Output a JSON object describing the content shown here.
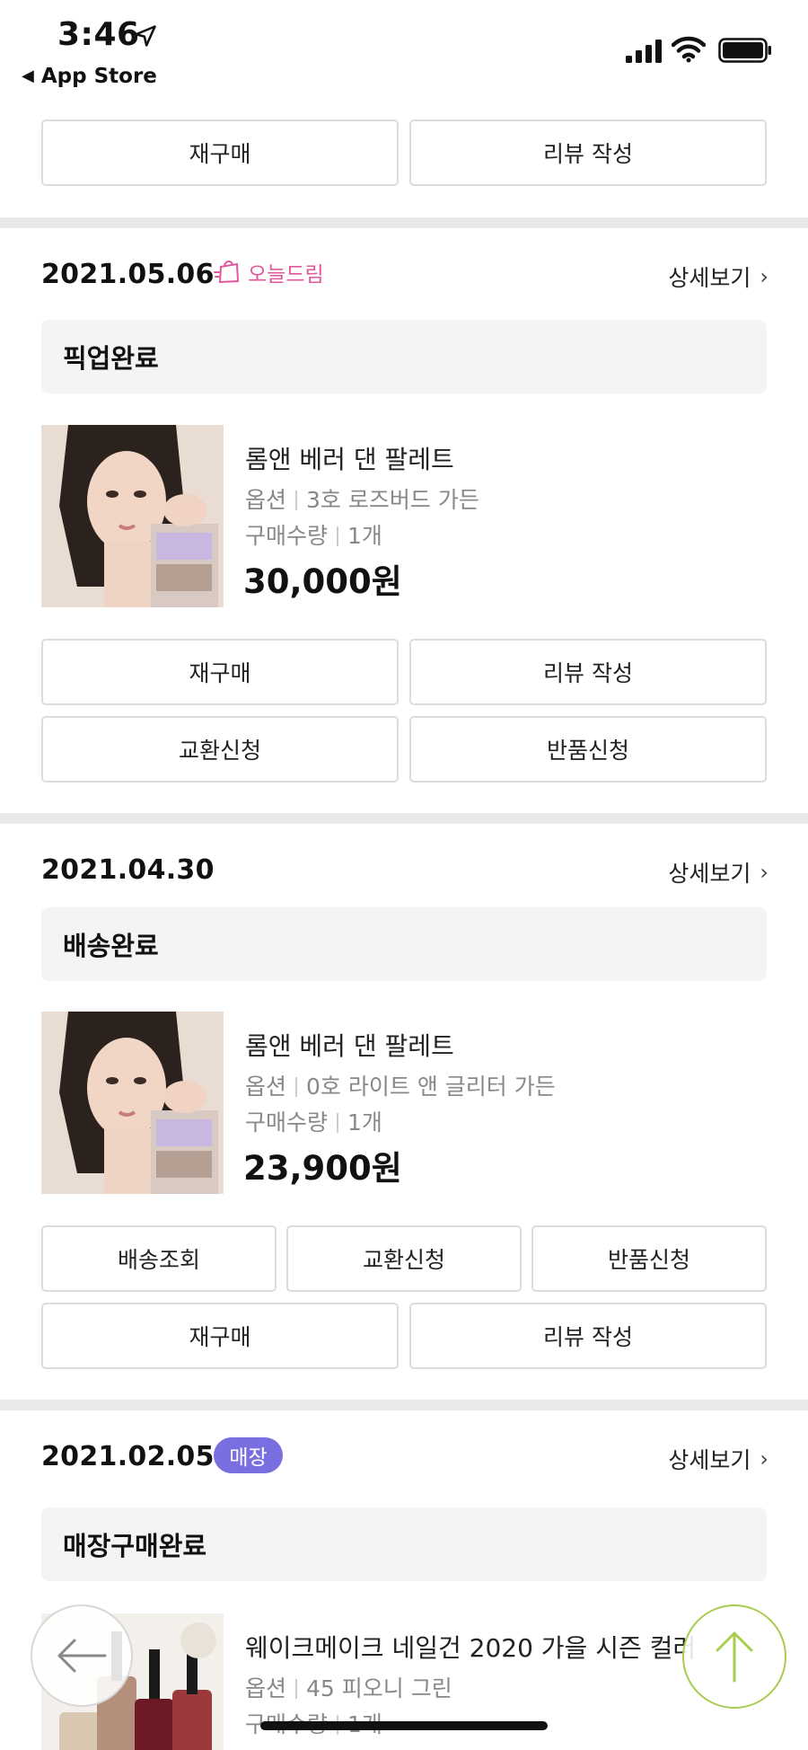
{
  "status_bar": {
    "time": "3:46",
    "back_label": "App Store"
  },
  "top_actions": {
    "rebuy": "재구매",
    "review": "리뷰 작성"
  },
  "orders": [
    {
      "date": "2021.05.06",
      "tag": "오늘드림",
      "detail": "상세보기",
      "status": "픽업완료",
      "product": {
        "name": "롬앤 베러 댄 팔레트",
        "option_label": "옵션",
        "option": "3호 로즈버드 가든",
        "qty_label": "구매수량",
        "qty": "1개",
        "price": "30,000원"
      },
      "buttons": [
        "재구매",
        "리뷰 작성",
        "교환신청",
        "반품신청"
      ]
    },
    {
      "date": "2021.04.30",
      "detail": "상세보기",
      "status": "배송완료",
      "product": {
        "name": "롬앤 베러 댄 팔레트",
        "option_label": "옵션",
        "option": "0호 라이트 앤 글리터 가든",
        "qty_label": "구매수량",
        "qty": "1개",
        "price": "23,900원"
      },
      "buttons": [
        "배송조회",
        "교환신청",
        "반품신청",
        "재구매",
        "리뷰 작성"
      ]
    },
    {
      "date": "2021.02.05",
      "tag": "매장",
      "detail": "상세보기",
      "status": "매장구매완료",
      "product": {
        "name": "웨이크메이크 네일건 2020 가을 시즌 컬러",
        "option_label": "옵션",
        "option": "45 피오니 그린",
        "qty_label": "구매수량",
        "qty": "1개"
      }
    }
  ],
  "colors": {
    "accent_pink": "#e0579b",
    "badge_purple": "#7a6fe0",
    "fab_green": "#a7cc4e"
  },
  "icons": [
    "location-arrow-icon",
    "signal-icon",
    "wifi-icon",
    "battery-icon",
    "shopping-bag-icon",
    "chevron-right-icon",
    "back-arrow-icon",
    "arrow-up-icon"
  ]
}
